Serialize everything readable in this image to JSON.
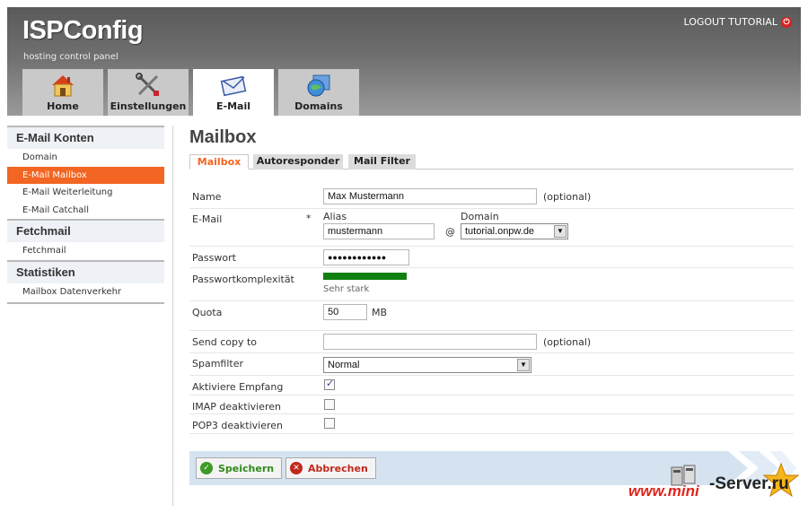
{
  "header": {
    "logo": "ISPConfig",
    "tagline": "hosting control panel",
    "logout": "LOGOUT TUTORIAL",
    "tabs": [
      {
        "label": "Home",
        "icon": "home-icon"
      },
      {
        "label": "Einstellungen",
        "icon": "tools-icon"
      },
      {
        "label": "E-Mail",
        "icon": "envelope-icon",
        "active": true
      },
      {
        "label": "Domains",
        "icon": "globe-folder-icon"
      }
    ]
  },
  "sidebar": {
    "sections": [
      {
        "title": "E-Mail Konten",
        "items": [
          "Domain",
          "E-Mail Mailbox",
          "E-Mail Weiterleitung",
          "E-Mail Catchall"
        ]
      },
      {
        "title": "Fetchmail",
        "items": [
          "Fetchmail"
        ]
      },
      {
        "title": "Statistiken",
        "items": [
          "Mailbox Datenverkehr"
        ]
      }
    ],
    "active_item": "E-Mail Mailbox"
  },
  "main": {
    "title": "Mailbox",
    "subtabs": [
      "Mailbox",
      "Autoresponder",
      "Mail Filter"
    ],
    "form": {
      "name_label": "Name",
      "name_value": "Max Mustermann",
      "optional": "(optional)",
      "email_label": "E-Mail",
      "required_mark": "*",
      "alias_label": "Alias",
      "alias_value": "mustermann",
      "at": "@",
      "domain_label": "Domain",
      "domain_value": "tutorial.onpw.de",
      "password_label": "Passwort",
      "password_value": "●●●●●●●●●●●●",
      "complexity_label": "Passwortkomplexität",
      "complexity_text": "Sehr stark",
      "complexity_level": 1.0,
      "quota_label": "Quota",
      "quota_value": "50",
      "quota_unit": "MB",
      "copy_label": "Send copy to",
      "copy_value": "",
      "spam_label": "Spamfilter",
      "spam_value": "Normal",
      "receive_label": "Aktiviere Empfang",
      "imap_label": "IMAP deaktivieren",
      "pop3_label": "POP3 deaktivieren"
    },
    "buttons": {
      "save": "Speichern",
      "cancel": "Abbrechen"
    }
  },
  "watermark": {
    "www": "www.mini",
    "server": "-Server.ru"
  },
  "colors": {
    "accent": "#f26522",
    "strength_bar": "#108010",
    "save_green": "#2f8a1b",
    "cancel_red": "#c0281d"
  }
}
